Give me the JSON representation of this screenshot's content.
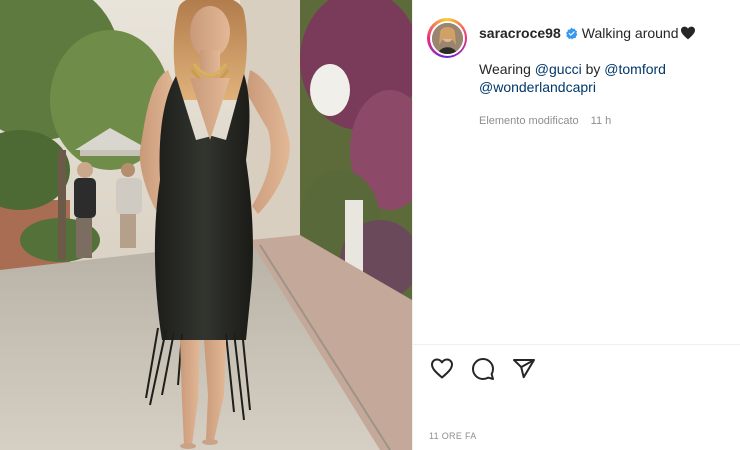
{
  "post": {
    "username": "saracroce98",
    "caption_line1": "Walking around",
    "caption_wearing": "Wearing",
    "mention_1": "@gucci",
    "caption_by": "by",
    "mention_2": "@tomford",
    "mention_3": "@wonderlandcapri",
    "edited_label": "Elemento modificato",
    "relative_time": "11 h",
    "timestamp": "11 ORE FA"
  },
  "icons": {
    "verified": "verified-badge-icon",
    "emoji": "black-heart-emoji",
    "like": "heart-outline-icon",
    "comment": "comment-bubble-icon",
    "share": "paper-plane-icon"
  },
  "colors": {
    "mention": "#00376b",
    "verified": "#3897f0",
    "meta": "#8e8e8e",
    "text": "#262626"
  }
}
